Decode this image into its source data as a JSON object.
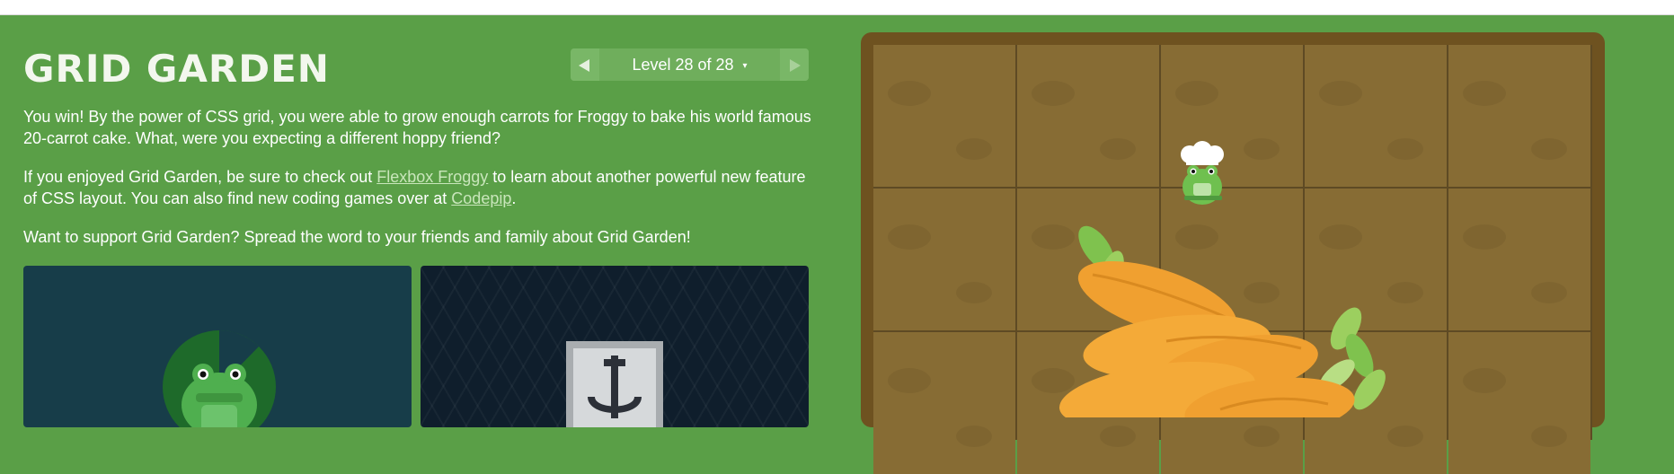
{
  "game": {
    "title": "GRID GARDEN",
    "level_indicator": "Level 28 of 28",
    "level_caret": "▾",
    "paragraphs": {
      "win_text": "You win! By the power of CSS grid, you were able to grow enough carrots for Froggy to bake his world famous 20-carrot cake. What, were you expecting a different hoppy friend?",
      "enjoy_prefix": "If you enjoyed Grid Garden, be sure to check out ",
      "flexbox_link": "Flexbox Froggy",
      "enjoy_middle": " to learn about another powerful new feature of CSS layout. You can also find new coding games over at ",
      "codepip_link": "Codepip",
      "enjoy_suffix": ".",
      "support_text": "Want to support Grid Garden? Spread the word to your friends and family about Grid Garden!"
    }
  },
  "icons": {
    "prev": "chevron-left-icon",
    "next": "chevron-right-icon",
    "frog": "frog-icon",
    "anchor": "anchor-icon",
    "chef_frog": "chef-frog-icon",
    "carrot_pile": "carrot-pile-icon"
  },
  "colors": {
    "background": "#5a9f47",
    "soil": "#876c34",
    "board_frame": "#6e5220",
    "carrot": "#f0a030",
    "leaf": "#9ccf5f",
    "link": "#c9e6bb"
  }
}
